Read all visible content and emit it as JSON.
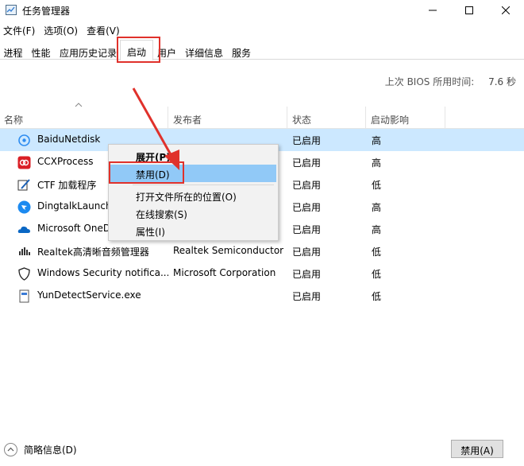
{
  "window": {
    "title": "任务管理器",
    "controls": {
      "minimize": "minimize-icon",
      "maximize": "maximize-icon",
      "close": "close-icon"
    }
  },
  "menubar": [
    "文件(F)",
    "选项(O)",
    "查看(V)"
  ],
  "tabs": [
    "进程",
    "性能",
    "应用历史记录",
    "启动",
    "用户",
    "详细信息",
    "服务"
  ],
  "active_tab": "启动",
  "boot_time": {
    "label": "上次 BIOS 所用时间:",
    "value": "7.6 秒"
  },
  "columns": {
    "name": "名称",
    "publisher": "发布者",
    "status": "状态",
    "impact": "启动影响"
  },
  "rows": [
    {
      "name": "BaiduNetdisk",
      "publisher": "",
      "status": "已启用",
      "impact": "高",
      "icon": "baidunetdisk-icon"
    },
    {
      "name": "CCXProcess",
      "publisher": "",
      "status": "已启用",
      "impact": "高",
      "icon": "adobe-cc-icon"
    },
    {
      "name": "CTF 加载程序",
      "publisher": "",
      "status": "已启用",
      "impact": "低",
      "icon": "ctf-loader-icon"
    },
    {
      "name": "DingtalkLauncher",
      "publisher": "",
      "status": "已启用",
      "impact": "高",
      "icon": "dingtalk-icon"
    },
    {
      "name": "Microsoft OneDrive",
      "publisher": "",
      "status": "已启用",
      "impact": "高",
      "icon": "onedrive-icon"
    },
    {
      "name": "Realtek高清晰音频管理器",
      "publisher": "Realtek Semiconductor",
      "status": "已启用",
      "impact": "低",
      "icon": "realtek-audio-icon"
    },
    {
      "name": "Windows Security notifica...",
      "publisher": "Microsoft Corporation",
      "status": "已启用",
      "impact": "低",
      "icon": "windows-security-icon"
    },
    {
      "name": "YunDetectService.exe",
      "publisher": "",
      "status": "已启用",
      "impact": "低",
      "icon": "exe-file-icon"
    }
  ],
  "context_menu": {
    "expand": "展开(P)",
    "disable": "禁用(D)",
    "open_location": "打开文件所在的位置(O)",
    "search_online": "在线搜索(S)",
    "properties": "属性(I)"
  },
  "footer": {
    "fewer_details": "简略信息(D)",
    "disable_button": "禁用(A)"
  },
  "colors": {
    "selection": "#cce8ff",
    "menu_highlight": "#91c9f7",
    "annotation_red": "#e0312b"
  }
}
